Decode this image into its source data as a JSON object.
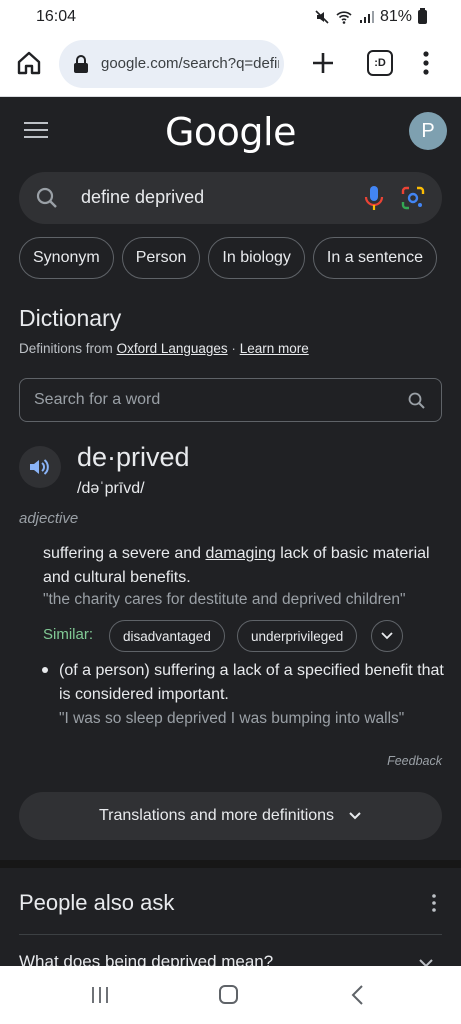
{
  "status_bar": {
    "time": "16:04",
    "battery": "81%"
  },
  "browser": {
    "url": "google.com/search?q=define+deprived",
    "tabs_icon_label": ":D"
  },
  "header": {
    "logo": "Google",
    "avatar_initial": "P"
  },
  "search": {
    "query": "define deprived"
  },
  "chips": [
    "Synonym",
    "Person",
    "In biology",
    "In a sentence"
  ],
  "dictionary": {
    "title": "Dictionary",
    "source_prefix": "Definitions from",
    "source_link": "Oxford Languages",
    "separator": "·",
    "learn_more": "Learn more",
    "search_placeholder": "Search for a word",
    "word": "de·prived",
    "phonetic": "/dəˈprīvd/",
    "part_of_speech": "adjective",
    "def1_before": "suffering a severe and ",
    "def1_link": "damaging",
    "def1_after": " lack of basic material and cultural benefits.",
    "example1": "\"the charity cares for destitute and deprived children\"",
    "similar_label": "Similar:",
    "similar": [
      "disadvantaged",
      "underprivileged"
    ],
    "def2": "(of a person) suffering a lack of a specified benefit that is considered important.",
    "example2": "\"I was so sleep deprived I was bumping into walls\"",
    "feedback": "Feedback",
    "translations": "Translations and more definitions"
  },
  "people_also_ask": {
    "title": "People also ask",
    "question1": "What does being deprived mean?"
  },
  "icons": {
    "home": "home-icon",
    "lock": "lock-icon",
    "new_tab": "plus-icon",
    "menu": "more-vert-icon",
    "search": "search-icon",
    "mic": "mic-icon",
    "lens": "lens-icon",
    "speaker": "speaker-icon"
  },
  "colors": {
    "background": "#202124",
    "surface": "#303134",
    "similar_green": "#81c995",
    "speaker_blue": "#8ab4f8"
  }
}
